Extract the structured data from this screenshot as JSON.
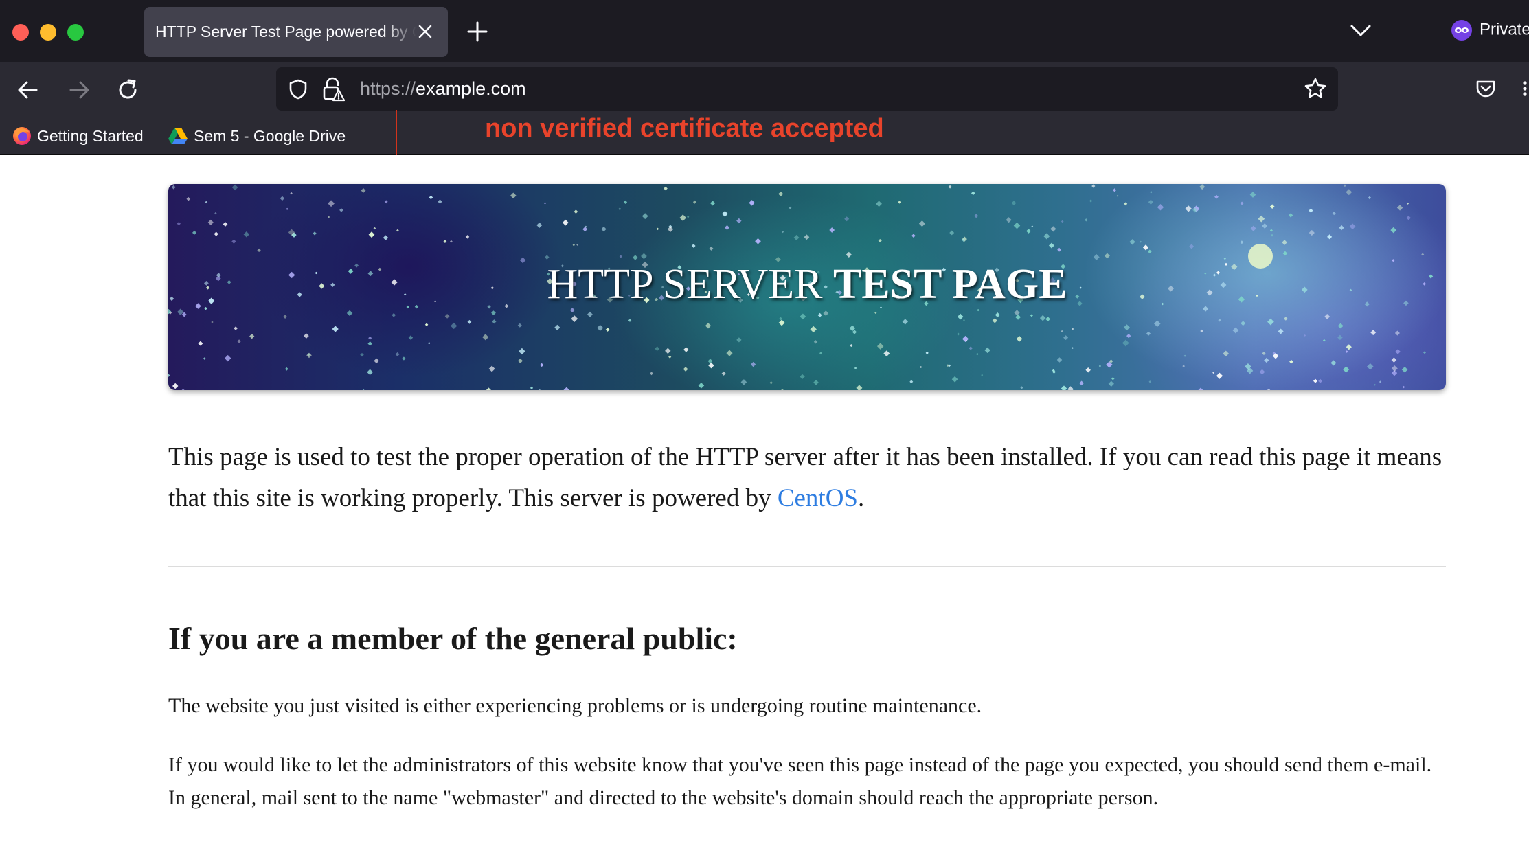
{
  "window": {
    "traffic_lights": {
      "close": "#ff5f57",
      "minimize": "#febc2e",
      "zoom": "#28c840"
    }
  },
  "tab": {
    "title": "HTTP Server Test Page powered by CentOS",
    "close_icon": "close-icon"
  },
  "tabstrip": {
    "new_tab_icon": "plus-icon",
    "list_tabs_icon": "chevron-down-icon",
    "private_label": "Private"
  },
  "navbar": {
    "back_icon": "arrow-left-icon",
    "forward_icon": "arrow-right-icon",
    "reload_icon": "reload-icon",
    "url_scheme": "https://",
    "url_host": "example.com",
    "pocket_icon": "pocket-icon"
  },
  "bookmarks": [
    {
      "label": "Getting Started",
      "icon": "firefox-icon"
    },
    {
      "label": "Sem 5 - Google Drive",
      "icon": "google-drive-icon"
    }
  ],
  "annotation": {
    "text": "non verified certificate accepted",
    "color": "#e8432b"
  },
  "page": {
    "banner_title_regular": "HTTP SERVER ",
    "banner_title_bold": "TEST PAGE",
    "intro_text": "This page is used to test the proper operation of the HTTP server after it has been installed. If you can read this page it means that this site is working properly. This server is powered by ",
    "intro_link": "CentOS",
    "intro_end": ".",
    "heading": "If you are a member of the general public:",
    "paragraph_1": "The website you just visited is either experiencing problems or is undergoing routine maintenance.",
    "paragraph_2": "If you would like to let the administrators of this website know that you've seen this page instead of the page you expected, you should send them e-mail. In general, mail sent to the name \"webmaster\" and directed to the website's domain should reach the appropriate person.",
    "link_color": "#2e7de1"
  }
}
